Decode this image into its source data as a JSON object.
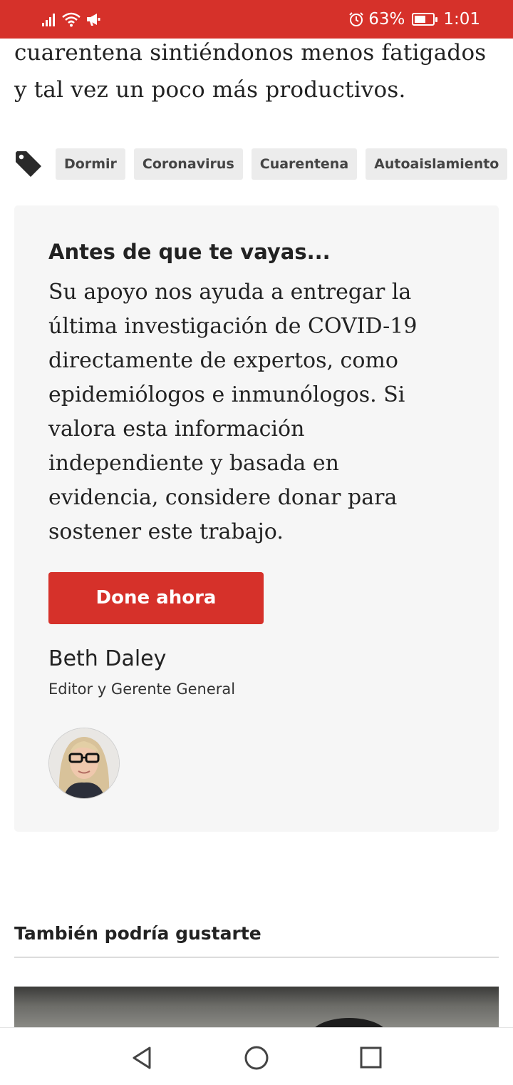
{
  "status_bar": {
    "battery_text": "63%",
    "battery_level": 0.63,
    "time": "1:01",
    "background_color": "#d6312a",
    "icons": [
      "signal-icon",
      "wifi-icon",
      "megaphone-icon",
      "alarm-icon",
      "battery-icon"
    ]
  },
  "article": {
    "text_lines": [
      "cuarentena sintiéndonos menos fatigados",
      "y tal vez un poco más productivos."
    ]
  },
  "tags": {
    "icon": "tag-icon",
    "items": [
      "Dormir",
      "Coronavirus",
      "Cuarentena",
      "Autoaislamiento"
    ]
  },
  "donation_card": {
    "title": "Antes de que te vayas...",
    "body_lines": [
      "Su apoyo nos ayuda a entregar la",
      "última investigación de COVID-19",
      "directamente de expertos, como",
      "epidemiólogos e inmunólogos. Si",
      "valora esta información",
      "independiente y basada en",
      "evidencia, considere donar para",
      "sostener este trabajo."
    ],
    "button_label": "Done ahora",
    "author_name": "Beth Daley",
    "author_role": "Editor y Gerente General",
    "accent_color": "#d6312a"
  },
  "related": {
    "title": "También podría gustarte"
  },
  "nav_bar": {
    "icons": [
      "back-icon",
      "home-icon",
      "recents-icon"
    ]
  }
}
